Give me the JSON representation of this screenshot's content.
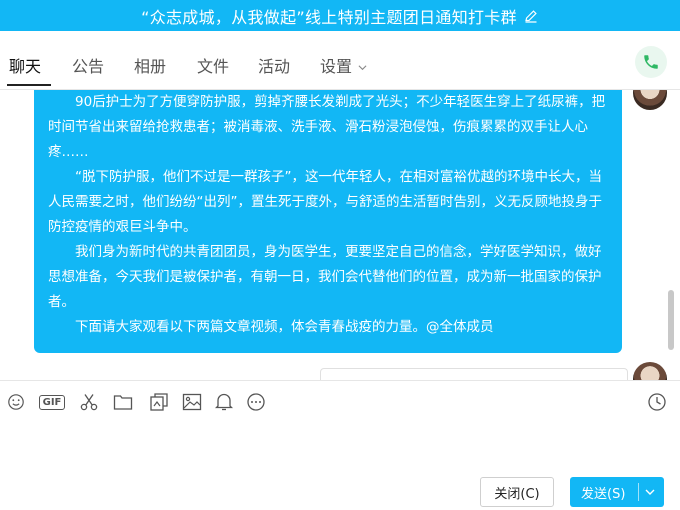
{
  "window": {
    "title": "“众志成城，从我做起”线上特别主题团日通知打卡群"
  },
  "tabs": [
    {
      "label": "聊天",
      "active": true
    },
    {
      "label": "公告"
    },
    {
      "label": "相册"
    },
    {
      "label": "文件"
    },
    {
      "label": "活动"
    },
    {
      "label": "设置"
    }
  ],
  "message": {
    "paragraphs": [
      "90后护士为了方便穿防护服，剪掉齐腰长发剃成了光头；不少年轻医生穿上了纸尿裤，把时间节省出来留给抢救患者；被消毒液、洗手液、滑石粉浸泡侵蚀，伤痕累累的双手让人心疼……",
      "“脱下防护服，他们不过是一群孩子”，这一代年轻人，在相对富裕优越的环境中长大，当人民需要之时，他们纷纷“出列”，置生死于度外，与舒适的生活暂时告别，义无反顾地投身于防控疫情的艰巨斗争中。",
      "我们身为新时代的共青团团员，身为医学生，更要坚定自己的信念，学好医学知识，做好思想准备，今天我们是被保护者，有朝一日，我们会代替他们的位置，成为新一批国家的保护者。",
      "下面请大家观看以下两篇文章视频，体会青春战疫的力量。@全体成员"
    ]
  },
  "toolbar_icons": [
    "emoji-icon",
    "gif-icon",
    "scissors-icon",
    "folder-icon",
    "sticker-icon",
    "image-icon",
    "bell-icon",
    "more-icon",
    "history-clock-icon"
  ],
  "toolbar": {
    "gif_label": "GIF"
  },
  "buttons": {
    "close_label": "关闭(C)",
    "send_label": "发送(S)"
  },
  "colors": {
    "accent": "#12b7f5",
    "phone_green": "#2fb865"
  }
}
